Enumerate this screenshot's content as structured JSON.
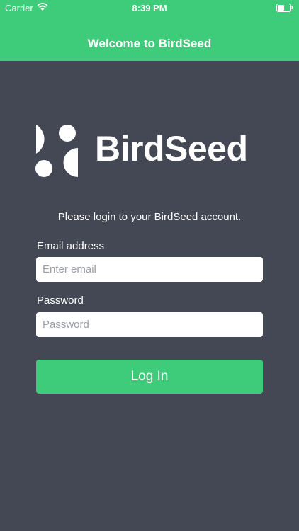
{
  "status_bar": {
    "carrier": "Carrier",
    "time": "8:39 PM",
    "icons": [
      "wifi-icon",
      "battery-icon"
    ]
  },
  "nav": {
    "title": "Welcome to BirdSeed"
  },
  "logo": {
    "wordmark": "BirdSeed"
  },
  "login": {
    "prompt": "Please login to your BirdSeed account.",
    "email_label": "Email address",
    "email_placeholder": "Enter email",
    "email_value": "",
    "password_label": "Password",
    "password_placeholder": "Password",
    "password_value": "",
    "button_label": "Log In"
  },
  "colors": {
    "accent": "#3fcc7a",
    "background": "#434854",
    "text": "#ffffff"
  }
}
